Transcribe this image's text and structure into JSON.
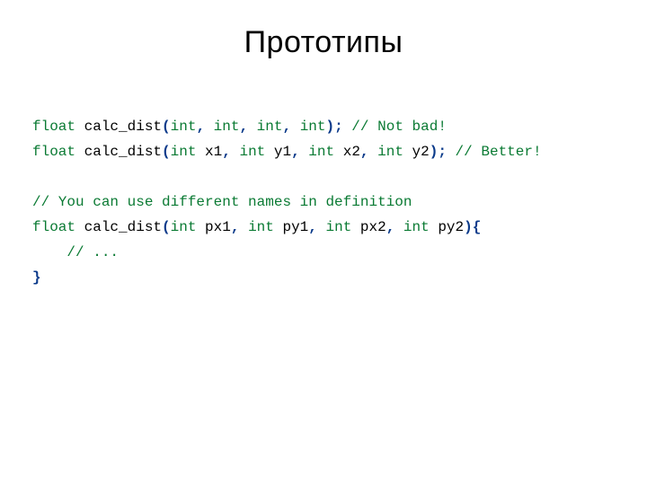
{
  "title": "Прототипы",
  "code": {
    "line1": {
      "t_float": "float",
      "fn": " calc_dist",
      "p_open": "(",
      "int1": "int",
      "c1": ",",
      "int2": " int",
      "c2": ",",
      "int3": " int",
      "c3": ",",
      "int4": " int",
      "p_close": ");",
      "cm": " // Not bad!"
    },
    "line2": {
      "t_float": "float",
      "fn": " calc_dist",
      "p_open": "(",
      "int1": "int",
      "a1": " x1",
      "c1": ",",
      "int2": " int",
      "a2": " y1",
      "c2": ",",
      "int3": " int",
      "a3": " x2",
      "c3": ",",
      "int4": " int",
      "a4": " y2",
      "p_close": ");",
      "cm": " // Better!"
    },
    "line3_blank": "",
    "line4_cm": "// You can use different names in definition",
    "line5": {
      "t_float": "float",
      "fn": " calc_dist",
      "p_open": "(",
      "int1": "int",
      "a1": " px1",
      "c1": ",",
      "int2": " int",
      "a2": " py1",
      "c2": ",",
      "int3": " int",
      "a3": " px2",
      "c3": ",",
      "int4": " int",
      "a4": " py2",
      "p_close": "){"
    },
    "line6_cm": "// ...",
    "line7_brace": "}"
  }
}
